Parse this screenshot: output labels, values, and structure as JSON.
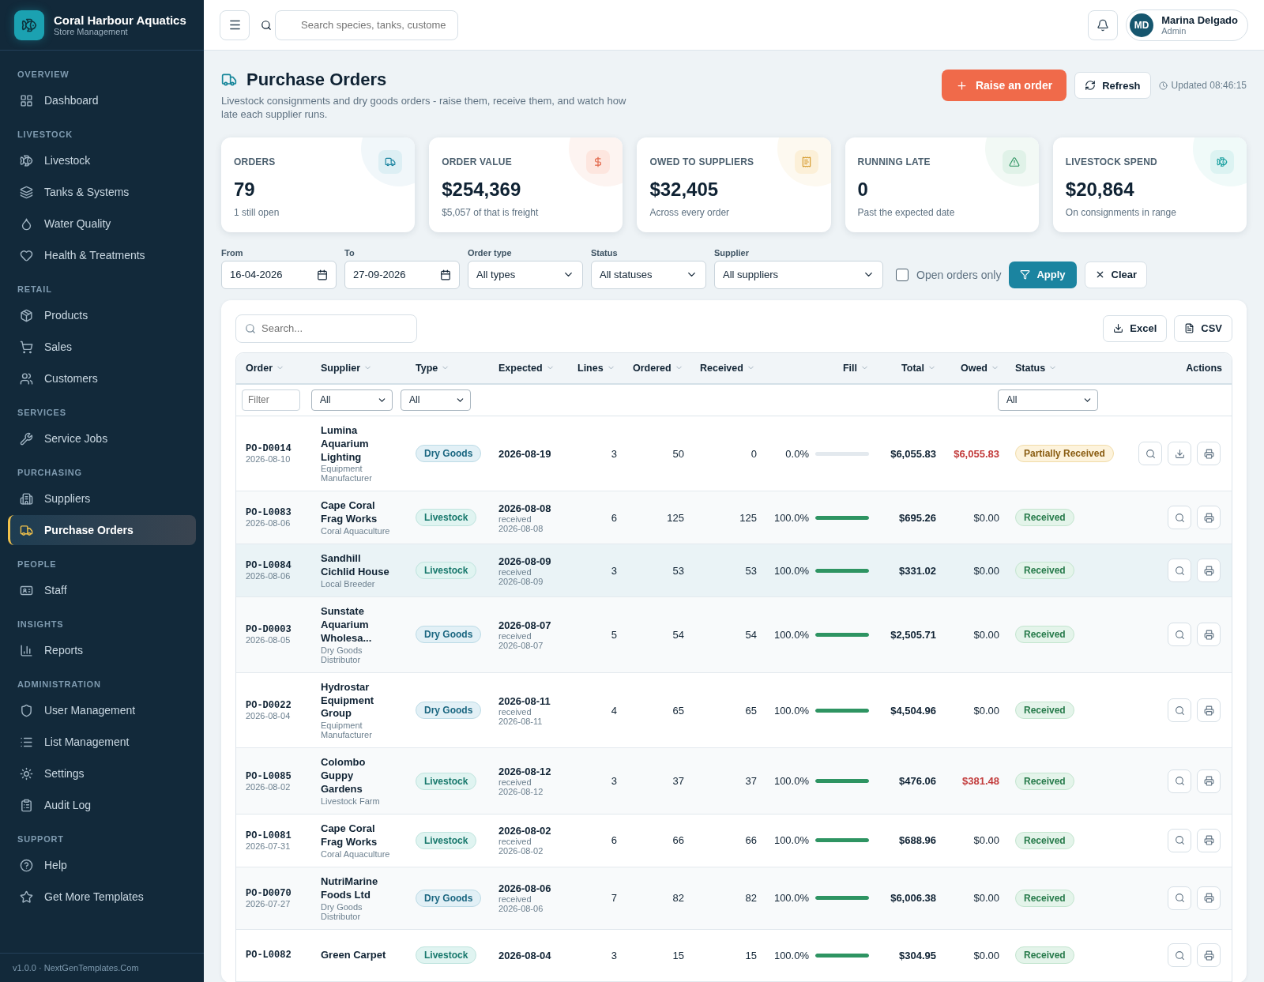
{
  "brand": {
    "name": "Coral Harbour Aquatics",
    "subtitle": "Store Management"
  },
  "sidebar": {
    "sections": [
      {
        "title": "OVERVIEW",
        "items": [
          {
            "label": "Dashboard",
            "selected": false
          }
        ]
      },
      {
        "title": "LIVESTOCK",
        "items": [
          {
            "label": "Livestock",
            "selected": false
          },
          {
            "label": "Tanks & Systems",
            "selected": false
          },
          {
            "label": "Water Quality",
            "selected": false
          },
          {
            "label": "Health & Treatments",
            "selected": false
          }
        ]
      },
      {
        "title": "RETAIL",
        "items": [
          {
            "label": "Products",
            "selected": false
          },
          {
            "label": "Sales",
            "selected": false
          },
          {
            "label": "Customers",
            "selected": false
          }
        ]
      },
      {
        "title": "SERVICES",
        "items": [
          {
            "label": "Service Jobs",
            "selected": false
          }
        ]
      },
      {
        "title": "PURCHASING",
        "items": [
          {
            "label": "Suppliers",
            "selected": false
          },
          {
            "label": "Purchase Orders",
            "selected": true
          }
        ]
      },
      {
        "title": "PEOPLE",
        "items": [
          {
            "label": "Staff",
            "selected": false
          }
        ]
      },
      {
        "title": "INSIGHTS",
        "items": [
          {
            "label": "Reports",
            "selected": false
          }
        ]
      },
      {
        "title": "ADMINISTRATION",
        "items": [
          {
            "label": "User Management",
            "selected": false
          },
          {
            "label": "List Management",
            "selected": false
          },
          {
            "label": "Settings",
            "selected": false
          },
          {
            "label": "Audit Log",
            "selected": false
          }
        ]
      },
      {
        "title": "SUPPORT",
        "items": [
          {
            "label": "Help",
            "selected": false
          },
          {
            "label": "Get More Templates",
            "selected": false
          }
        ]
      }
    ],
    "footer": "v1.0.0 · NextGenTemplates.Com"
  },
  "header": {
    "search_placeholder": "Search species, tanks, custome",
    "user": {
      "initials": "MD",
      "name": "Marina Delgado",
      "role": "Admin"
    }
  },
  "page": {
    "title": "Purchase Orders",
    "description": "Livestock consignments and dry goods orders - raise them, receive them, and watch how late each supplier runs.",
    "primary_action": "Raise an order",
    "refresh": "Refresh",
    "updated": "Updated 08:46:15"
  },
  "stats": [
    {
      "kind": "orders",
      "label": "ORDERS",
      "value": "79",
      "note": "1 still open"
    },
    {
      "kind": "value",
      "label": "ORDER VALUE",
      "value": "$254,369",
      "note": "$5,057 of that is freight"
    },
    {
      "kind": "owed",
      "label": "OWED TO SUPPLIERS",
      "value": "$32,405",
      "note": "Across every order"
    },
    {
      "kind": "late",
      "label": "RUNNING LATE",
      "value": "0",
      "note": "Past the expected date"
    },
    {
      "kind": "livestock",
      "label": "LIVESTOCK SPEND",
      "value": "$20,864",
      "note": "On consignments in range"
    }
  ],
  "filters": {
    "fields": [
      {
        "kind": "date",
        "label": "From",
        "value": "16-04-2026"
      },
      {
        "kind": "date",
        "label": "To",
        "value": "27-09-2026"
      },
      {
        "kind": "select",
        "label": "Order type",
        "value": "All types"
      },
      {
        "kind": "select",
        "label": "Status",
        "value": "All statuses"
      },
      {
        "kind": "select",
        "label": "Supplier",
        "value": "All suppliers"
      }
    ],
    "open_only": {
      "label": "Open orders only",
      "checked": false
    },
    "apply": "Apply",
    "clear": "Clear"
  },
  "table": {
    "search_placeholder": "Search...",
    "exports": [
      "Excel",
      "CSV"
    ],
    "columns": [
      {
        "label": "Order",
        "sortable": true
      },
      {
        "label": "Supplier",
        "sortable": true
      },
      {
        "label": "Type",
        "sortable": true
      },
      {
        "label": "Expected",
        "sortable": true
      },
      {
        "label": "Lines",
        "sortable": true
      },
      {
        "label": "Ordered",
        "sortable": true
      },
      {
        "label": "Received",
        "sortable": true
      },
      {
        "label": "Fill",
        "sortable": true
      },
      {
        "label": "Total",
        "sortable": true
      },
      {
        "label": "Owed",
        "sortable": true
      },
      {
        "label": "Status",
        "sortable": true
      },
      {
        "label": "Actions",
        "sortable": false
      }
    ],
    "column_filters": {
      "order": {
        "placeholder": "Filter"
      },
      "supplier": "All",
      "type": "All",
      "status": "All"
    },
    "rows": [
      {
        "order": "PO-D0014",
        "date": "2026-08-10",
        "supplier": "Lumina Aquarium Lighting",
        "supplier_type": "Equipment Manufacturer",
        "type": {
          "label": "Dry Goods",
          "kind": "dry"
        },
        "expected": "2026-08-19",
        "lines": "3",
        "ordered": "50",
        "received": "0",
        "fill": "0.0%",
        "level": 0,
        "total": "$6,055.83",
        "owed": "$6,055.83",
        "owed_outstanding": true,
        "status": {
          "label": "Partially Received",
          "kind": "partial"
        },
        "can_receive": true,
        "selected": false
      },
      {
        "order": "PO-L0083",
        "date": "2026-08-06",
        "supplier": "Cape Coral Frag Works",
        "supplier_type": "Coral Aquaculture",
        "type": {
          "label": "Livestock",
          "kind": "livestock"
        },
        "expected": "2026-08-08",
        "received_note": "received",
        "received_date": "2026-08-08",
        "lines": "6",
        "ordered": "125",
        "received": "125",
        "fill": "100.0%",
        "level": 1,
        "total": "$695.26",
        "owed": "$0.00",
        "owed_outstanding": false,
        "status": {
          "label": "Received",
          "kind": "received"
        },
        "can_receive": false,
        "selected": false
      },
      {
        "order": "PO-L0084",
        "date": "2026-08-06",
        "supplier": "Sandhill Cichlid House",
        "supplier_type": "Local Breeder",
        "type": {
          "label": "Livestock",
          "kind": "livestock"
        },
        "expected": "2026-08-09",
        "received_note": "received",
        "received_date": "2026-08-09",
        "lines": "3",
        "ordered": "53",
        "received": "53",
        "fill": "100.0%",
        "level": 1,
        "total": "$331.02",
        "owed": "$0.00",
        "owed_outstanding": false,
        "status": {
          "label": "Received",
          "kind": "received"
        },
        "can_receive": false,
        "selected": true
      },
      {
        "order": "PO-D0003",
        "date": "2026-08-05",
        "supplier": "Sunstate Aquarium Wholesa...",
        "supplier_type": "Dry Goods Distributor",
        "type": {
          "label": "Dry Goods",
          "kind": "dry"
        },
        "expected": "2026-08-07",
        "received_note": "received",
        "received_date": "2026-08-07",
        "lines": "5",
        "ordered": "54",
        "received": "54",
        "fill": "100.0%",
        "level": 1,
        "total": "$2,505.71",
        "owed": "$0.00",
        "owed_outstanding": false,
        "status": {
          "label": "Received",
          "kind": "received"
        },
        "can_receive": false,
        "selected": false
      },
      {
        "order": "PO-D0022",
        "date": "2026-08-04",
        "supplier": "Hydrostar Equipment Group",
        "supplier_type": "Equipment Manufacturer",
        "type": {
          "label": "Dry Goods",
          "kind": "dry"
        },
        "expected": "2026-08-11",
        "received_note": "received",
        "received_date": "2026-08-11",
        "lines": "4",
        "ordered": "65",
        "received": "65",
        "fill": "100.0%",
        "level": 1,
        "total": "$4,504.96",
        "owed": "$0.00",
        "owed_outstanding": false,
        "status": {
          "label": "Received",
          "kind": "received"
        },
        "can_receive": false,
        "selected": false
      },
      {
        "order": "PO-L0085",
        "date": "2026-08-02",
        "supplier": "Colombo Guppy Gardens",
        "supplier_type": "Livestock Farm",
        "type": {
          "label": "Livestock",
          "kind": "livestock"
        },
        "expected": "2026-08-12",
        "received_note": "received",
        "received_date": "2026-08-12",
        "lines": "3",
        "ordered": "37",
        "received": "37",
        "fill": "100.0%",
        "level": 1,
        "total": "$476.06",
        "owed": "$381.48",
        "owed_outstanding": true,
        "status": {
          "label": "Received",
          "kind": "received"
        },
        "can_receive": false,
        "selected": false
      },
      {
        "order": "PO-L0081",
        "date": "2026-07-31",
        "supplier": "Cape Coral Frag Works",
        "supplier_type": "Coral Aquaculture",
        "type": {
          "label": "Livestock",
          "kind": "livestock"
        },
        "expected": "2026-08-02",
        "received_note": "received",
        "received_date": "2026-08-02",
        "lines": "6",
        "ordered": "66",
        "received": "66",
        "fill": "100.0%",
        "level": 1,
        "total": "$688.96",
        "owed": "$0.00",
        "owed_outstanding": false,
        "status": {
          "label": "Received",
          "kind": "received"
        },
        "can_receive": false,
        "selected": false
      },
      {
        "order": "PO-D0070",
        "date": "2026-07-27",
        "supplier": "NutriMarine Foods Ltd",
        "supplier_type": "Dry Goods Distributor",
        "type": {
          "label": "Dry Goods",
          "kind": "dry"
        },
        "expected": "2026-08-06",
        "received_note": "received",
        "received_date": "2026-08-06",
        "lines": "7",
        "ordered": "82",
        "received": "82",
        "fill": "100.0%",
        "level": 1,
        "total": "$6,006.38",
        "owed": "$0.00",
        "owed_outstanding": false,
        "status": {
          "label": "Received",
          "kind": "received"
        },
        "can_receive": false,
        "selected": false
      },
      {
        "order": "PO-L0082",
        "supplier": "Green Carpet",
        "type": {
          "label": "Livestock",
          "kind": "livestock"
        },
        "expected": "2026-08-04",
        "lines": "3",
        "ordered": "15",
        "received": "15",
        "fill": "100.0%",
        "level": 1,
        "total": "$304.95",
        "owed": "$0.00",
        "owed_outstanding": false,
        "status": {
          "label": "Received",
          "kind": "received"
        },
        "can_receive": false,
        "selected": false
      }
    ]
  }
}
